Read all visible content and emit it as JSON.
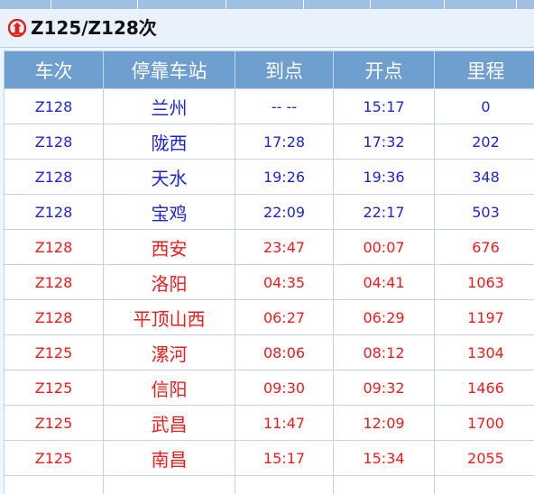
{
  "title": "Z125/Z128次",
  "table": {
    "headers": [
      "车次",
      "停靠车站",
      "到点",
      "开点",
      "里程"
    ],
    "rows": [
      {
        "train": "Z128",
        "station": "兰州",
        "arrive": "-- --",
        "depart": "15:17",
        "mileage": "0",
        "color": "blue"
      },
      {
        "train": "Z128",
        "station": "陇西",
        "arrive": "17:28",
        "depart": "17:32",
        "mileage": "202",
        "color": "blue"
      },
      {
        "train": "Z128",
        "station": "天水",
        "arrive": "19:26",
        "depart": "19:36",
        "mileage": "348",
        "color": "blue"
      },
      {
        "train": "Z128",
        "station": "宝鸡",
        "arrive": "22:09",
        "depart": "22:17",
        "mileage": "503",
        "color": "blue"
      },
      {
        "train": "Z128",
        "station": "西安",
        "arrive": "23:47",
        "depart": "00:07",
        "mileage": "676",
        "color": "red"
      },
      {
        "train": "Z128",
        "station": "洛阳",
        "arrive": "04:35",
        "depart": "04:41",
        "mileage": "1063",
        "color": "red"
      },
      {
        "train": "Z128",
        "station": "平顶山西",
        "arrive": "06:27",
        "depart": "06:29",
        "mileage": "1197",
        "color": "red"
      },
      {
        "train": "Z125",
        "station": "漯河",
        "arrive": "08:06",
        "depart": "08:12",
        "mileage": "1304",
        "color": "red"
      },
      {
        "train": "Z125",
        "station": "信阳",
        "arrive": "09:30",
        "depart": "09:32",
        "mileage": "1466",
        "color": "red"
      },
      {
        "train": "Z125",
        "station": "武昌",
        "arrive": "11:47",
        "depart": "12:09",
        "mileage": "1700",
        "color": "red"
      },
      {
        "train": "Z125",
        "station": "南昌",
        "arrive": "15:17",
        "depart": "15:34",
        "mileage": "2055",
        "color": "red"
      }
    ]
  },
  "colors": {
    "header_bg": "#6f9fcf",
    "blue_text": "#1f25d6",
    "red_text": "#ee1c1c",
    "logo_red": "#e0201b"
  },
  "icons": {
    "logo": "railway-logo-icon"
  }
}
